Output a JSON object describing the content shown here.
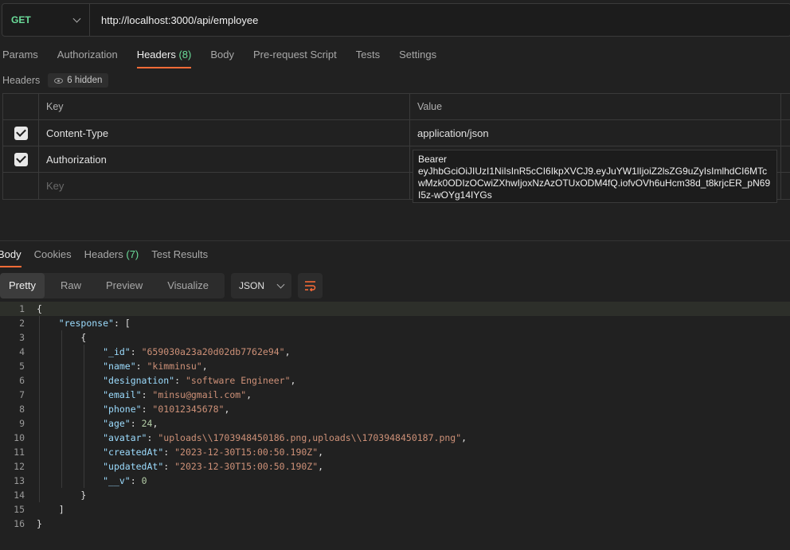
{
  "request": {
    "method": "GET",
    "url": "http://localhost:3000/api/employee"
  },
  "request_tabs": [
    {
      "label": "Params"
    },
    {
      "label": "Authorization"
    },
    {
      "label": "Headers",
      "count": "(8)"
    },
    {
      "label": "Body"
    },
    {
      "label": "Pre-request Script"
    },
    {
      "label": "Tests"
    },
    {
      "label": "Settings"
    }
  ],
  "headers_section": {
    "title": "Headers",
    "hidden": "6 hidden",
    "columns": {
      "key": "Key",
      "value": "Value"
    },
    "rows": [
      {
        "key": "Content-Type",
        "value": "application/json",
        "checked": true
      },
      {
        "key": "Authorization",
        "value": "",
        "checked": true
      }
    ],
    "new_key_placeholder": "Key",
    "auth_value_editor": "Bearer\neyJhbGciOiJIUzI1NiIsInR5cCI6IkpXVCJ9.eyJuYW1lIjoiZ2lsZG9uZyIsImlhdCI6MTcwMzk0ODIzOCwiZXhwIjoxNzAzOTUxODM4fQ.iofvOVh6uHcm38d_t8krjcER_pN69I5z-wOYg14IYGs"
  },
  "response_tabs": [
    {
      "label": "Body"
    },
    {
      "label": "Cookies"
    },
    {
      "label": "Headers",
      "count": "(7)"
    },
    {
      "label": "Test Results"
    }
  ],
  "view_modes": [
    "Pretty",
    "Raw",
    "Preview",
    "Visualize"
  ],
  "format": "JSON",
  "code_lines": [
    {
      "n": "1",
      "text": "{"
    },
    {
      "n": "2",
      "text": "    \"response\": ["
    },
    {
      "n": "3",
      "text": "        {"
    },
    {
      "n": "4",
      "text": "            \"_id\": \"659030a23a20d02db7762e94\","
    },
    {
      "n": "5",
      "text": "            \"name\": \"kimminsu\","
    },
    {
      "n": "6",
      "text": "            \"designation\": \"software Engineer\","
    },
    {
      "n": "7",
      "text": "            \"email\": \"minsu@gmail.com\","
    },
    {
      "n": "8",
      "text": "            \"phone\": \"01012345678\","
    },
    {
      "n": "9",
      "text": "            \"age\": 24,"
    },
    {
      "n": "10",
      "text": "            \"avatar\": \"uploads\\\\1703948450186.png,uploads\\\\1703948450187.png\","
    },
    {
      "n": "11",
      "text": "            \"createdAt\": \"2023-12-30T15:00:50.190Z\","
    },
    {
      "n": "12",
      "text": "            \"updatedAt\": \"2023-12-30T15:00:50.190Z\","
    },
    {
      "n": "13",
      "text": "            \"__v\": 0"
    },
    {
      "n": "14",
      "text": "        }"
    },
    {
      "n": "15",
      "text": "    ]"
    },
    {
      "n": "16",
      "text": "}"
    }
  ]
}
